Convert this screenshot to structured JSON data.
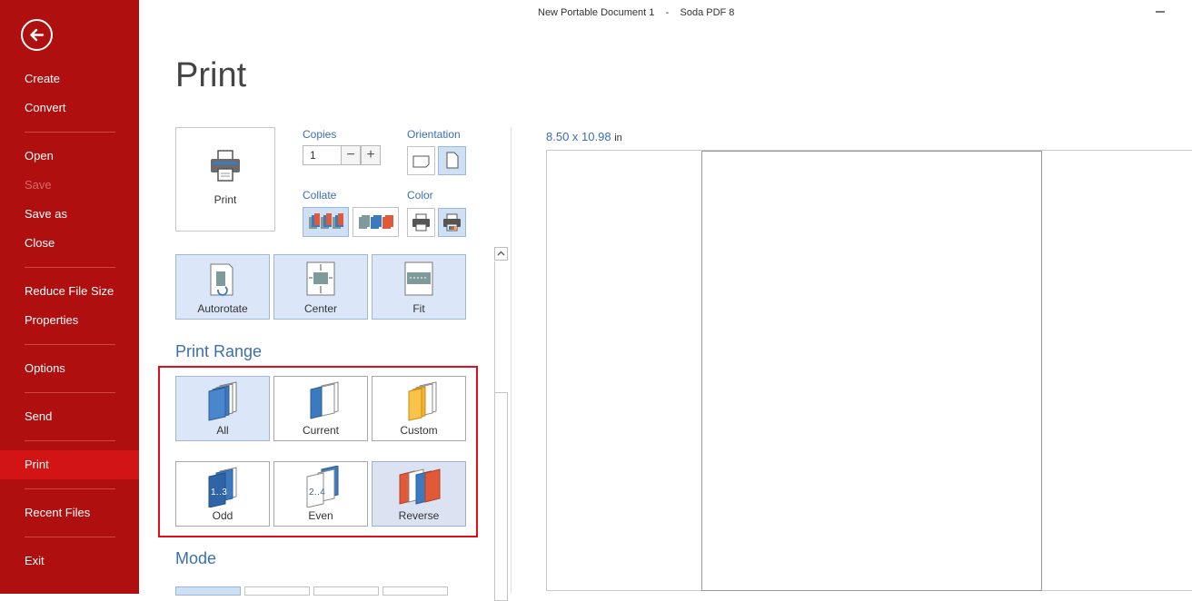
{
  "window": {
    "title": "New Portable Document 1    -    Soda PDF 8"
  },
  "sidebar": {
    "items": [
      {
        "label": "Create"
      },
      {
        "label": "Convert"
      },
      {
        "label": "Open"
      },
      {
        "label": "Save",
        "disabled": true
      },
      {
        "label": "Save as"
      },
      {
        "label": "Close"
      },
      {
        "label": "Reduce File Size"
      },
      {
        "label": "Properties"
      },
      {
        "label": "Options"
      },
      {
        "label": "Send"
      },
      {
        "label": "Print",
        "active": true
      },
      {
        "label": "Recent Files"
      },
      {
        "label": "Exit"
      }
    ]
  },
  "page": {
    "title": "Print"
  },
  "print_button": {
    "label": "Print"
  },
  "copies": {
    "label": "Copies",
    "value": "1"
  },
  "orientation": {
    "label": "Orientation",
    "selected": "portrait"
  },
  "collate": {
    "label": "Collate",
    "selected": "collated"
  },
  "color": {
    "label": "Color",
    "selected": "color"
  },
  "layout": {
    "autorotate": "Autorotate",
    "center": "Center",
    "fit": "Fit"
  },
  "print_range": {
    "title": "Print Range",
    "all": "All",
    "current": "Current",
    "custom": "Custom",
    "odd": "Odd",
    "even": "Even",
    "reverse": "Reverse",
    "selected": "all"
  },
  "mode": {
    "title": "Mode"
  },
  "preview": {
    "size": "8.50 x 10.98",
    "unit": "in"
  },
  "colors": {
    "sidebar": "#b00f0f",
    "sidebar_active": "#d21414",
    "accent": "#3a6fb0",
    "highlight": "#e10d18"
  }
}
